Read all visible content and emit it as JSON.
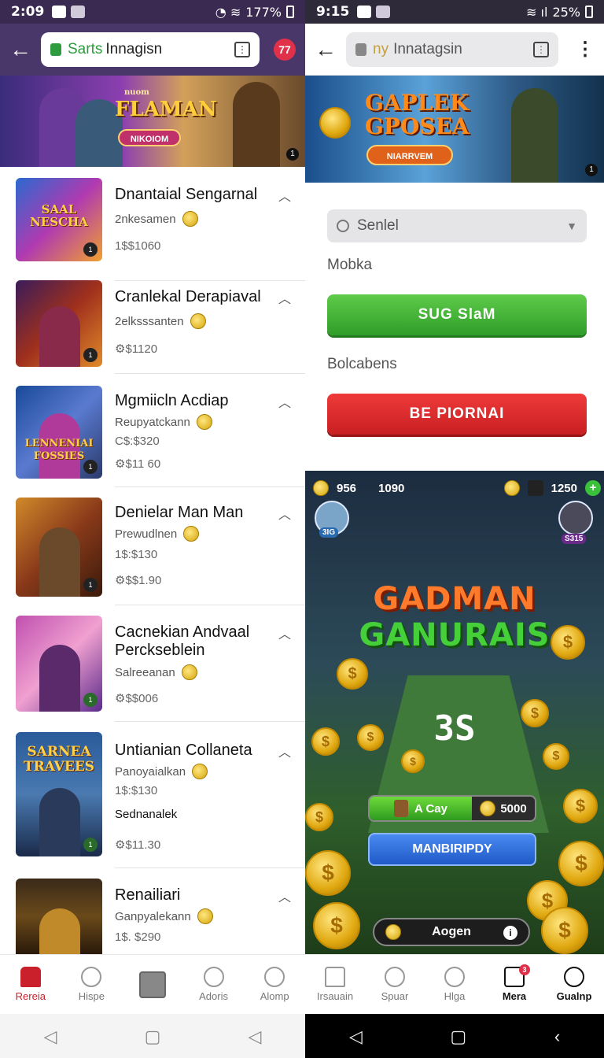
{
  "left": {
    "status": {
      "time": "2:09",
      "battery": "177%"
    },
    "url": {
      "prefix": "Sarts",
      "text": "Innagisn"
    },
    "notif_count": "77",
    "banner": {
      "title": "FLAMAN",
      "small": "nuom",
      "button": "NIKOIOM",
      "page": "1"
    },
    "items": [
      {
        "name": "Dnantaial Sengarnal",
        "sub": "2nkesamen",
        "l1": "1$$1060",
        "l2": "",
        "thumb_text": "SAAL NESCHA",
        "corner": "1"
      },
      {
        "name": "Cranlekal Derapiaval",
        "sub": "2elksssanten",
        "l1": "",
        "l2": "⚙$1120",
        "thumb_text": "",
        "corner": "1"
      },
      {
        "name": "Mgmiicln Acdiap",
        "sub": "Reupyatckann",
        "l1": "C$:$320",
        "l2": "⚙$11 60",
        "thumb_text": "LENNENIAI FOSSIES",
        "corner": "1"
      },
      {
        "name": "Denielar Man Man",
        "sub": "Prewudlnen",
        "l1": "1$:$130",
        "l2": "⚙$$1.90",
        "thumb_text": "",
        "corner": "1"
      },
      {
        "name": "Cacnekian Andvaal Perckseblein",
        "sub": "Salreeanan",
        "l1": "",
        "l2": "⚙$$006",
        "thumb_text": "",
        "corner": "1"
      },
      {
        "name": "Untianian Collaneta",
        "sub": "Panoyaialkan",
        "l1": "1$:$130",
        "l2": "⚙$11.30",
        "extra": "Sednanalek",
        "thumb_text": "SARNEA TRAVEES",
        "corner": "1"
      },
      {
        "name": "Renailiari",
        "sub": "Ganpyalekann",
        "l1": "1$. $290",
        "l2": "",
        "thumb_text": "",
        "corner": ""
      }
    ],
    "nav": [
      "Rereia",
      "Hispe",
      "",
      "Adoris",
      "Alomp"
    ]
  },
  "right": {
    "status": {
      "time": "9:15",
      "battery": "25%"
    },
    "url": {
      "prefix": "ny",
      "text": "Innatagsin"
    },
    "banner": {
      "title1": "GAPLEK",
      "title2": "GPOSEA",
      "button": "NIARRVEM",
      "page": "1"
    },
    "select_placeholder": "Senlel",
    "label1": "Mobka",
    "btn_green": "SUG SlaM",
    "label2": "Bolcabens",
    "btn_red": "BE PIORNAI",
    "game": {
      "hud_coins": "956",
      "hud_gems": "1090",
      "hud_score": "1250",
      "avatar_left": "3IG",
      "avatar_right": "S315",
      "title1": "GADMAN",
      "title2": "GANURAIS",
      "score": "3S",
      "pill_label": "A Cay",
      "pill_value": "5000",
      "blue_button": "MANBIRIPDY",
      "dark_button": "Aogen"
    },
    "nav": [
      "Irsauain",
      "Spuar",
      "Hlga",
      "Mera",
      "Gualnp"
    ],
    "mail_badge": "3"
  },
  "colors": {
    "accent_red": "#c9202c",
    "green": "#2f9d29",
    "red": "#c81f22",
    "blue": "#1f5ac8"
  }
}
